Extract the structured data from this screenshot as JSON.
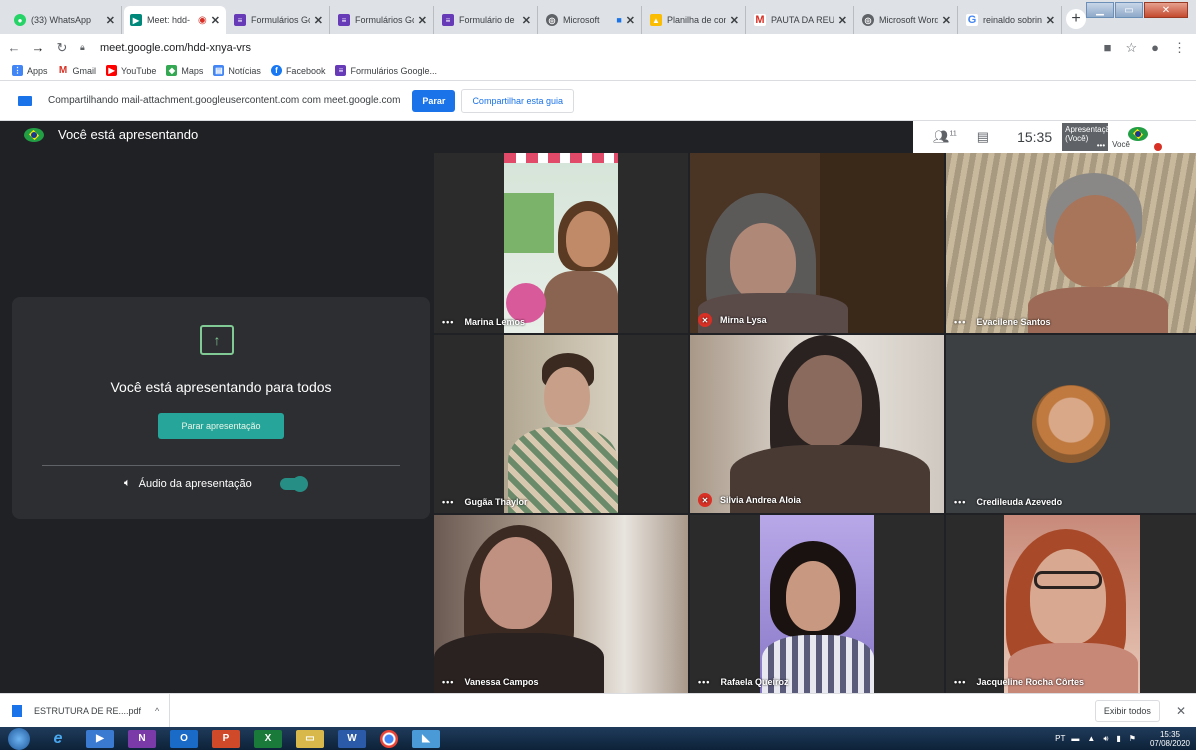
{
  "browser": {
    "tabs": [
      {
        "title": "(33) WhatsApp",
        "icon": "whatsapp-icon",
        "color": "#25d366"
      },
      {
        "title": "Meet: hdd-",
        "icon": "meet-icon",
        "color": "#00897b",
        "active": true
      },
      {
        "title": "Formulários Go",
        "icon": "forms-icon",
        "color": "#673ab7"
      },
      {
        "title": "Formulários Go",
        "icon": "forms-icon",
        "color": "#673ab7"
      },
      {
        "title": "Formulário de",
        "icon": "forms-icon",
        "color": "#673ab7"
      },
      {
        "title": "Microsoft",
        "icon": "chrome-icon",
        "color": "#5f6368"
      },
      {
        "title": "Planilha de con",
        "icon": "drive-icon",
        "color": "#fbbc04"
      },
      {
        "title": "PAUTA DA REU",
        "icon": "gmail-icon",
        "color": "#d93025"
      },
      {
        "title": "Microsoft Word",
        "icon": "chrome-icon",
        "color": "#5f6368"
      },
      {
        "title": "reinaldo sobrin",
        "icon": "google-icon",
        "color": "#4285f4"
      }
    ],
    "url": "meet.google.com/hdd-xnya-vrs",
    "bookmarks": [
      {
        "label": "Apps",
        "color": "#4285f4"
      },
      {
        "label": "Gmail",
        "color": "#d93025"
      },
      {
        "label": "YouTube",
        "color": "#ff0000"
      },
      {
        "label": "Maps",
        "color": "#34a853"
      },
      {
        "label": "Notícias",
        "color": "#4285f4"
      },
      {
        "label": "Facebook",
        "color": "#1877f2"
      },
      {
        "label": "Formulários Google...",
        "color": "#673ab7"
      }
    ]
  },
  "sharebar": {
    "text": "Compartilhando mail-attachment.googleusercontent.com com meet.google.com",
    "stop_label": "Parar",
    "share_tab_label": "Compartilhar esta guia"
  },
  "meet": {
    "header": "Você está apresentando",
    "participant_count": "11",
    "clock": "15:35",
    "mini_presentation_label": "Apresentação (Você)",
    "mini_self_label": "Você",
    "present_card": {
      "title": "Você está apresentando para todos",
      "stop_label": "Parar apresentação",
      "audio_label": "Áudio da apresentação"
    },
    "tiles": [
      {
        "name": "Marina Lemos",
        "muted": false
      },
      {
        "name": "Mirna Lysa",
        "muted": true
      },
      {
        "name": "Evacilene Santos",
        "muted": false
      },
      {
        "name": "Gugãa Thaylor",
        "muted": false
      },
      {
        "name": "Silvia Andrea Aloia",
        "muted": true
      },
      {
        "name": "Credileuda Azevedo",
        "muted": false
      },
      {
        "name": "Vanessa Campos",
        "muted": false
      },
      {
        "name": "Rafaela Queiroz",
        "muted": false
      },
      {
        "name": "Jacqueline Rocha Côrtes",
        "muted": false
      }
    ]
  },
  "downloads": {
    "file": "ESTRUTURA DE RE....pdf",
    "show_all": "Exibir todos"
  },
  "taskbar": {
    "lang": "PT",
    "time": "15:35",
    "date": "07/08/2020"
  }
}
